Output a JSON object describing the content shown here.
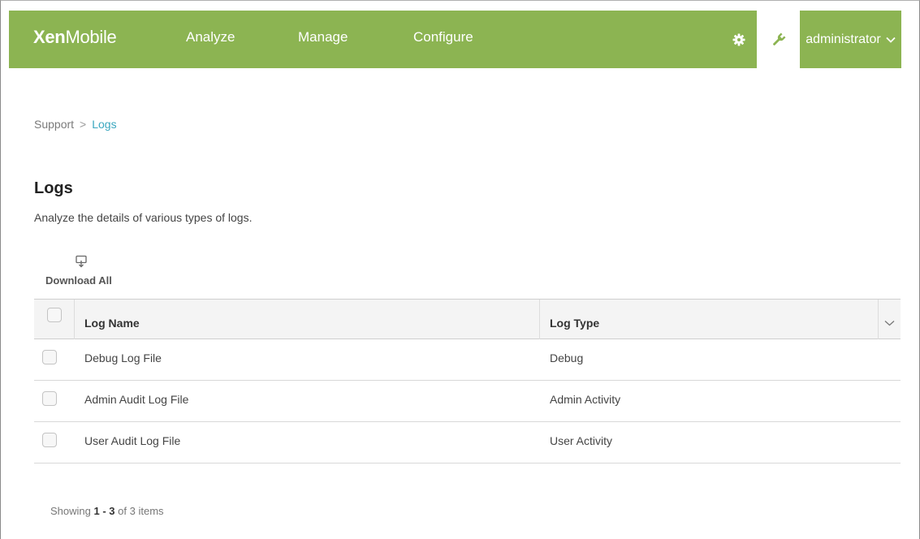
{
  "app": {
    "brand_bold": "Xen",
    "brand_light": "Mobile"
  },
  "nav": {
    "items": [
      {
        "label": "Analyze"
      },
      {
        "label": "Manage"
      },
      {
        "label": "Configure"
      }
    ],
    "settings_icon": "gear-icon",
    "support_icon": "wrench-icon",
    "user": "administrator",
    "user_chevron": "chevron-down-icon"
  },
  "breadcrumb": {
    "parent": "Support",
    "separator": ">",
    "current": "Logs"
  },
  "page": {
    "title": "Logs",
    "subtitle": "Analyze the details of various types of logs."
  },
  "toolbar": {
    "download_all_label": "Download All",
    "download_icon": "download-icon"
  },
  "table": {
    "columns": [
      "Log Name",
      "Log Type"
    ],
    "rows": [
      {
        "name": "Debug Log File",
        "type": "Debug"
      },
      {
        "name": "Admin Audit Log File",
        "type": "Admin Activity"
      },
      {
        "name": "User Audit Log File",
        "type": "User Activity"
      }
    ]
  },
  "pager": {
    "prefix": "Showing",
    "range": "1 - 3",
    "of_text": "of",
    "total": "3",
    "suffix": "items"
  },
  "colors": {
    "nav_bg": "#8cb452",
    "link": "#3aa7bf"
  }
}
